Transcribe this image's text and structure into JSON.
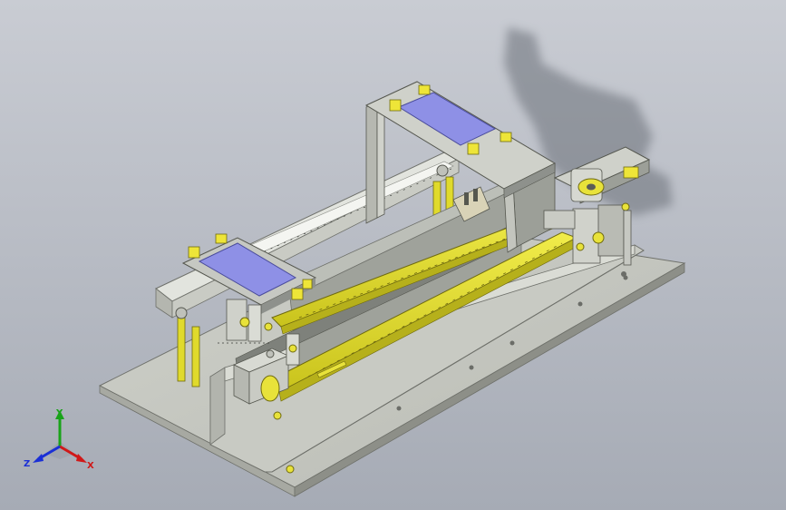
{
  "viewport": {
    "background_top": "#c9ccd3",
    "background_bottom": "#a6abb5"
  },
  "model": {
    "part_colors": {
      "frame": "#c6c8c2",
      "frame_dark": "#8e918c",
      "base_plate": "#bfc1ba",
      "belt": "#e2dc2a",
      "belt_dark": "#a8a31a",
      "pad": "#8e90e6",
      "bracket": "#d9d3b7"
    }
  },
  "triad": {
    "x_label": "X",
    "y_label": "Y",
    "z_label": "Z",
    "x_color": "#d01818",
    "y_color": "#19a319",
    "z_color": "#1a2fd6"
  }
}
